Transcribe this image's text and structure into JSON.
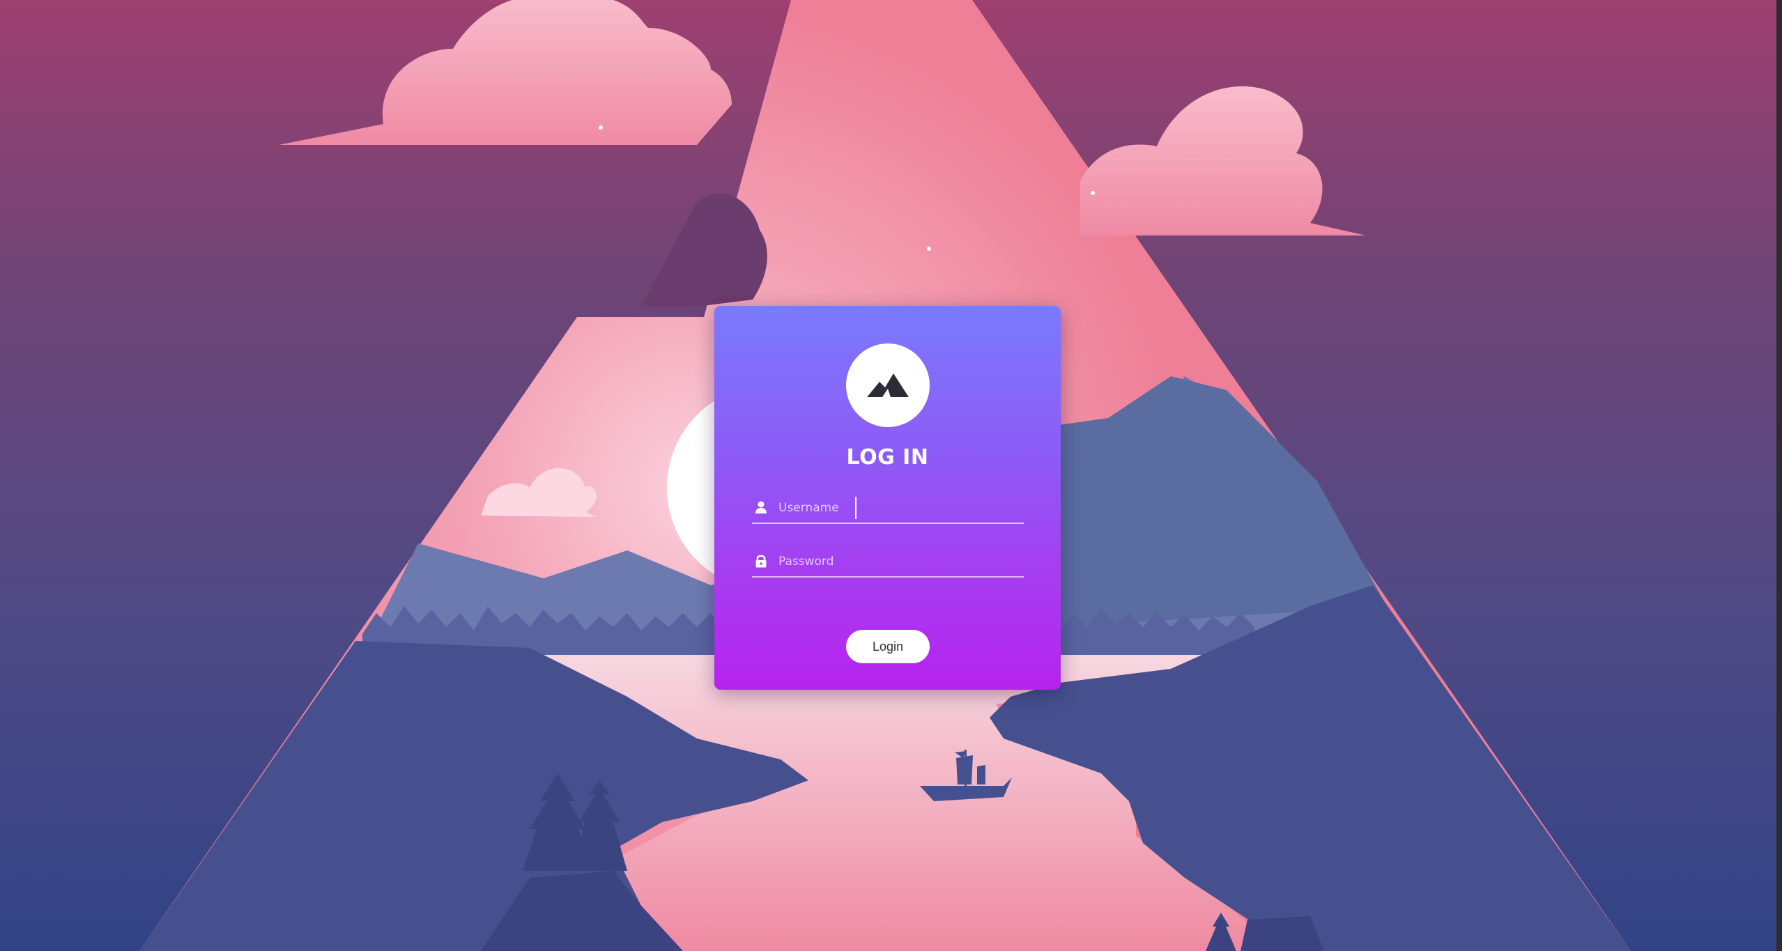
{
  "login_card": {
    "title": "LOG IN",
    "logo_icon": "mountain-icon",
    "username": {
      "placeholder": "Username",
      "value": "",
      "icon": "user-icon"
    },
    "password": {
      "placeholder": "Password",
      "value": "",
      "icon": "lock-icon"
    },
    "submit_label": "Login"
  },
  "colors": {
    "card_top": "#7a7afd",
    "card_bottom": "#b623ee",
    "button_bg": "#ffffff",
    "sky_top": "#9e4070",
    "sky_bottom": "#314386",
    "mountain_fill": "#4a5395"
  },
  "background": {
    "description_icon": "mountain-landscape-illustration"
  }
}
